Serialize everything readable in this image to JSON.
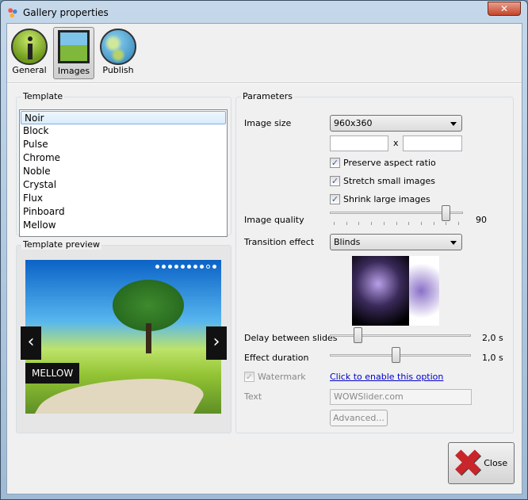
{
  "window": {
    "title": "Gallery properties",
    "close_glyph": "✕"
  },
  "toolbar": [
    {
      "label": "General",
      "icon": "info-icon"
    },
    {
      "label": "Images",
      "icon": "image-icon",
      "selected": true
    },
    {
      "label": "Publish",
      "icon": "globe-icon"
    }
  ],
  "template": {
    "label": "Template",
    "items": [
      "Noir",
      "Block",
      "Pulse",
      "Chrome",
      "Noble",
      "Crystal",
      "Flux",
      "Pinboard",
      "Mellow"
    ],
    "selected": "Noir"
  },
  "preview": {
    "label": "Template preview",
    "caption": "MELLOW",
    "prev": "‹",
    "next": "›",
    "dots": 10
  },
  "params": {
    "label": "Parameters",
    "image_size": {
      "label": "Image size",
      "value": "960x360",
      "width": "",
      "height": "",
      "x": "x"
    },
    "preserve": {
      "label": "Preserve aspect ratio",
      "checked": true
    },
    "stretch": {
      "label": "Stretch small images",
      "checked": true
    },
    "shrink": {
      "label": "Shrink large images",
      "checked": true
    },
    "quality": {
      "label": "Image quality",
      "value": "90",
      "fraction": 0.9
    },
    "transition": {
      "label": "Transition effect",
      "value": "Blinds"
    },
    "delay": {
      "label": "Delay between slides",
      "value": "2,0 s",
      "fraction": 0.18
    },
    "duration": {
      "label": "Effect duration",
      "value": "1,0 s",
      "fraction": 0.47
    },
    "watermark": {
      "label": "Watermark",
      "checked": true,
      "link": "Click to enable this option"
    },
    "text": {
      "label": "Text",
      "value": "WOWSlider.com"
    },
    "advanced": "Advanced..."
  },
  "close_button": "Close"
}
